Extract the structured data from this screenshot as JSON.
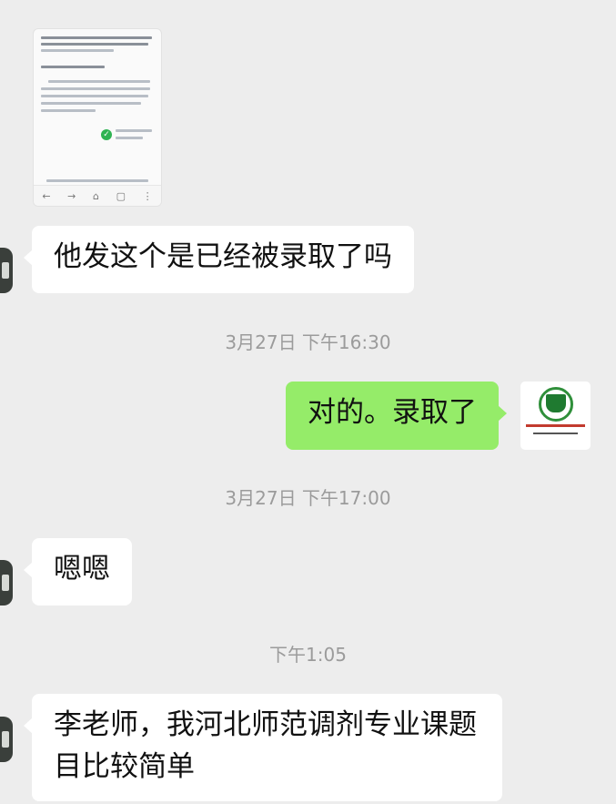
{
  "conversation": {
    "image_message": {
      "nav_icons": [
        "back-icon",
        "forward-icon",
        "home-icon",
        "tabs-icon",
        "more-icon"
      ],
      "nav_glyphs": [
        "←",
        "→",
        "⌂",
        "▢",
        "⋮"
      ]
    },
    "messages": [
      {
        "side": "left",
        "text": "他发这个是已经被录取了吗"
      },
      {
        "side": "right",
        "text": "对的。录取了"
      },
      {
        "side": "left",
        "text": "嗯嗯"
      },
      {
        "side": "left",
        "text": "李老师，我河北师范调剂专业课题目比较简单"
      }
    ],
    "timestamps": [
      "3月27日 下午16:30",
      "3月27日 下午17:00",
      "下午1:05"
    ]
  },
  "colors": {
    "background": "#ededed",
    "self_bubble": "#95ec69",
    "other_bubble": "#ffffff",
    "timestamp_text": "#9b9b9b"
  }
}
